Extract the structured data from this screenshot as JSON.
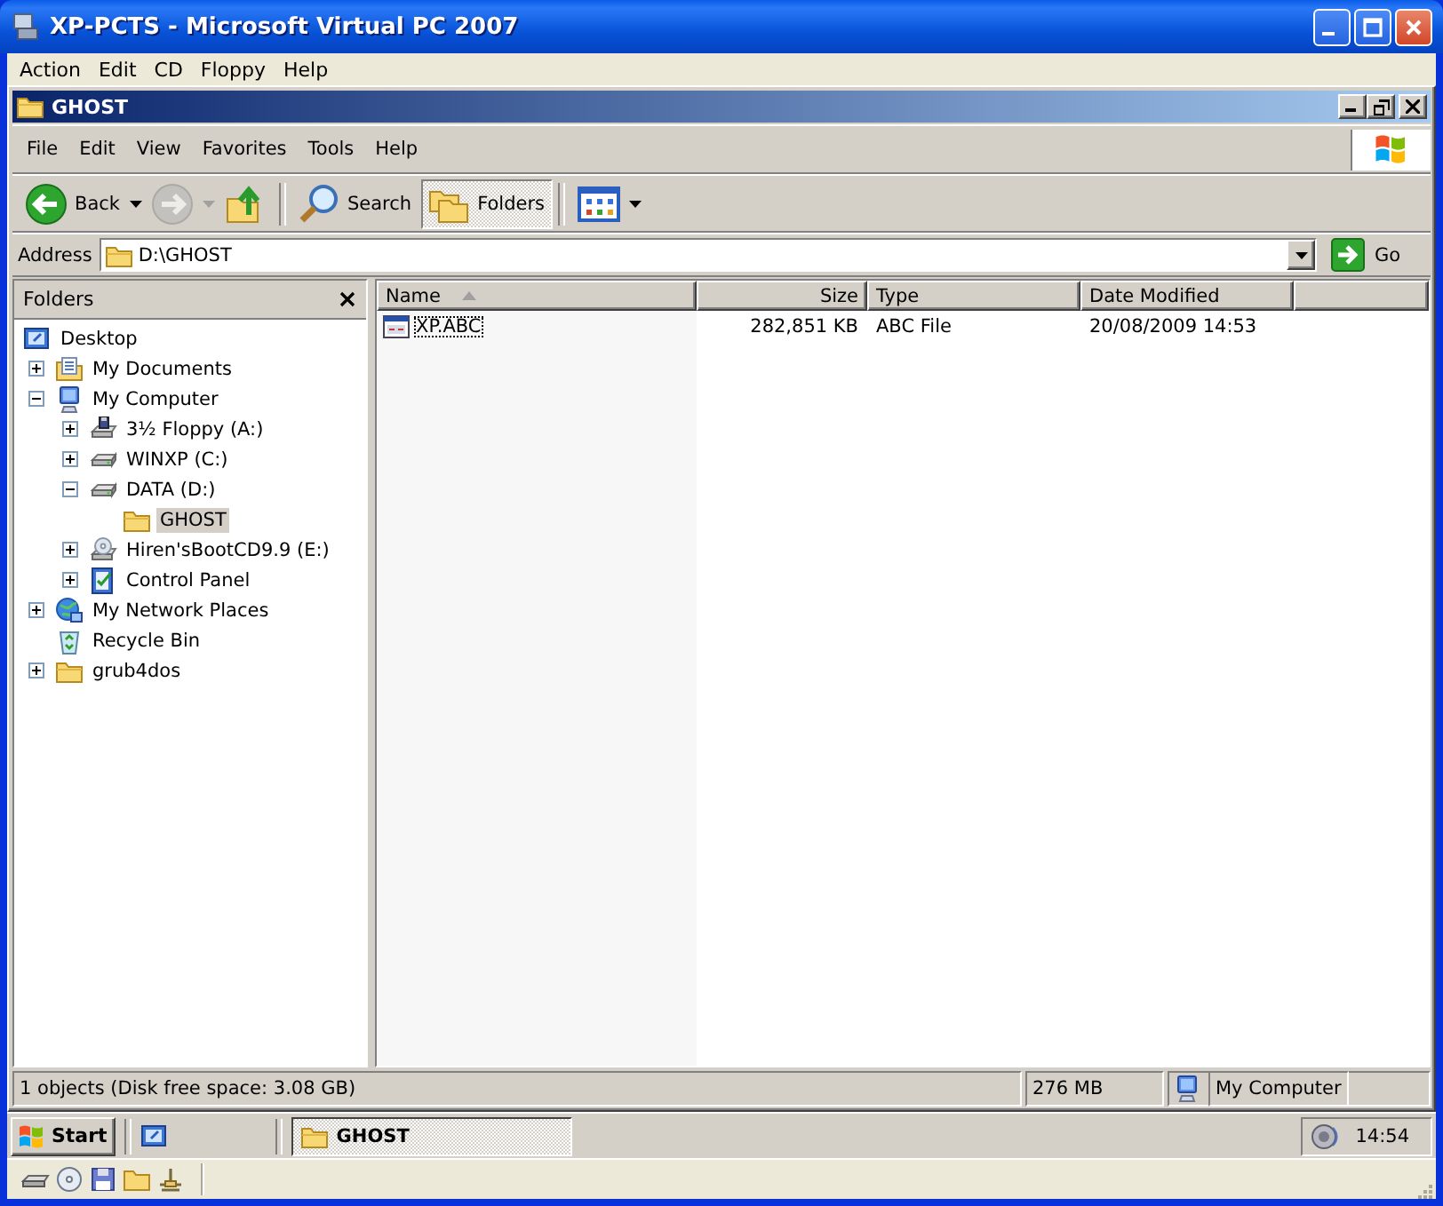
{
  "window": {
    "title": "XP-PCTS - Microsoft Virtual PC 2007"
  },
  "host_menu": [
    "Action",
    "Edit",
    "CD",
    "Floppy",
    "Help"
  ],
  "explorer": {
    "title": "GHOST",
    "menu": [
      "File",
      "Edit",
      "View",
      "Favorites",
      "Tools",
      "Help"
    ],
    "toolbar": [
      {
        "kind": "back",
        "label": "Back",
        "pressed": false,
        "disabled": false
      },
      {
        "kind": "forward",
        "pressed": false,
        "disabled": true
      },
      {
        "kind": "up",
        "pressed": false,
        "disabled": false
      },
      {
        "kind": "search",
        "label": "Search",
        "pressed": false,
        "disabled": false
      },
      {
        "kind": "folders",
        "label": "Folders",
        "pressed": true,
        "disabled": false
      },
      {
        "kind": "views",
        "pressed": false,
        "disabled": false
      }
    ],
    "address": {
      "label": "Address",
      "value": "D:\\GHOST",
      "go": "Go"
    },
    "folders_pane": {
      "title": "Folders",
      "tree": [
        {
          "label": "Desktop",
          "kind": "desktop",
          "selected": false,
          "children": [
            {
              "label": "My Documents",
              "kind": "documents",
              "expanded": false,
              "selected": false
            },
            {
              "label": "My Computer",
              "kind": "computer",
              "expanded": true,
              "selected": false,
              "children": [
                {
                  "label": "3½ Floppy (A:)",
                  "kind": "floppy",
                  "expanded": false,
                  "selected": false
                },
                {
                  "label": "WINXP (C:)",
                  "kind": "drive",
                  "expanded": false,
                  "selected": false
                },
                {
                  "label": "DATA (D:)",
                  "kind": "drive",
                  "expanded": true,
                  "selected": false,
                  "children": [
                    {
                      "label": "GHOST",
                      "kind": "folder",
                      "selected": true
                    }
                  ]
                },
                {
                  "label": "Hiren'sBootCD9.9 (E:)",
                  "kind": "cd",
                  "expanded": false,
                  "selected": false
                },
                {
                  "label": "Control Panel",
                  "kind": "control",
                  "expanded": false,
                  "selected": false
                }
              ]
            },
            {
              "label": "My Network Places",
              "kind": "network",
              "expanded": false,
              "selected": false
            },
            {
              "label": "Recycle Bin",
              "kind": "recycle",
              "selected": false
            },
            {
              "label": "grub4dos",
              "kind": "folder",
              "expanded": false,
              "selected": false
            }
          ]
        }
      ]
    },
    "file_list": {
      "columns": [
        {
          "label": "Name",
          "kind": "text",
          "sorted": true
        },
        {
          "label": "Size",
          "kind": "number",
          "sorted": false
        },
        {
          "label": "Type",
          "kind": "text",
          "sorted": false
        },
        {
          "label": "Date Modified",
          "kind": "text",
          "sorted": false
        }
      ],
      "rows": [
        {
          "cells": [
            "XP.ABC",
            "282,851 KB",
            "ABC File",
            "20/08/2009 14:53"
          ],
          "focused": true
        }
      ]
    },
    "status_bar": [
      "1 objects (Disk free space: 3.08 GB)",
      "276 MB",
      "My Computer"
    ]
  },
  "taskbar": {
    "start": "Start",
    "tasks": [
      {
        "label": "GHOST",
        "selected": true
      }
    ],
    "clock": "14:54"
  }
}
